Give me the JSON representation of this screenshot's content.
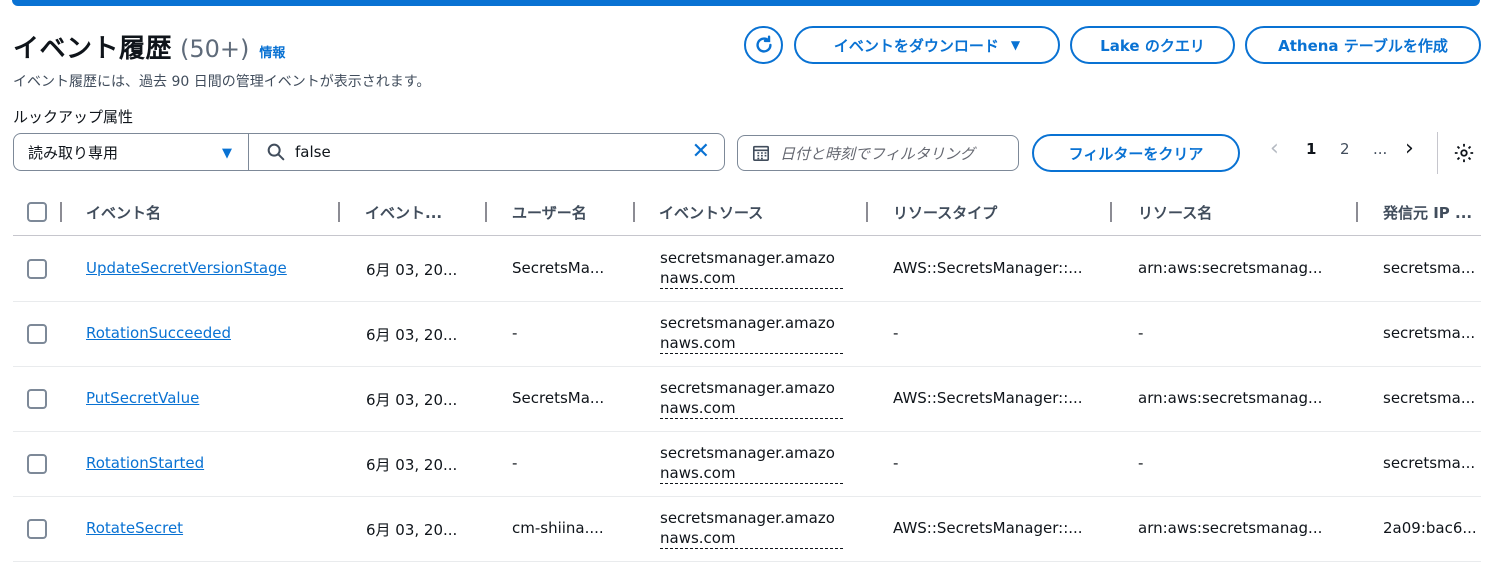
{
  "header": {
    "title": "イベント履歴",
    "count": "(50+)",
    "info_link": "情報",
    "description": "イベント履歴には、過去 90 日間の管理イベントが表示されます。"
  },
  "actions": {
    "download_label": "イベントをダウンロード",
    "lake_label": "Lake のクエリ",
    "athena_label": "Athena テーブルを作成"
  },
  "filter": {
    "lookup_label": "ルックアップ属性",
    "lookup_value": "読み取り専用",
    "search_value": "false",
    "date_placeholder": "日付と時刻でフィルタリング",
    "clear_label": "フィルターをクリア"
  },
  "pagination": {
    "pages": [
      "1",
      "2",
      "..."
    ],
    "current": "1"
  },
  "table": {
    "columns": [
      "イベント名",
      "イベント...",
      "ユーザー名",
      "イベントソース",
      "リソースタイプ",
      "リソース名",
      "発信元 IP ..."
    ],
    "rows": [
      {
        "event_name": "UpdateSecretVersionStage",
        "event_time": "6月 03, 20...",
        "user": "SecretsMa...",
        "source_line1": "secretsmanager.amazo",
        "source_line2": "naws.com",
        "resource_type": "AWS::SecretsManager::...",
        "resource_name": "arn:aws:secretsmanag...",
        "source_ip": "secretsma..."
      },
      {
        "event_name": "RotationSucceeded",
        "event_time": "6月 03, 20...",
        "user": "-",
        "source_line1": "secretsmanager.amazo",
        "source_line2": "naws.com",
        "resource_type": "-",
        "resource_name": "-",
        "source_ip": "secretsma..."
      },
      {
        "event_name": "PutSecretValue",
        "event_time": "6月 03, 20...",
        "user": "SecretsMa...",
        "source_line1": "secretsmanager.amazo",
        "source_line2": "naws.com",
        "resource_type": "AWS::SecretsManager::...",
        "resource_name": "arn:aws:secretsmanag...",
        "source_ip": "secretsma..."
      },
      {
        "event_name": "RotationStarted",
        "event_time": "6月 03, 20...",
        "user": "-",
        "source_line1": "secretsmanager.amazo",
        "source_line2": "naws.com",
        "resource_type": "-",
        "resource_name": "-",
        "source_ip": "secretsma..."
      },
      {
        "event_name": "RotateSecret",
        "event_time": "6月 03, 20...",
        "user": "cm-shiina....",
        "source_line1": "secretsmanager.amazo",
        "source_line2": "naws.com",
        "resource_type": "AWS::SecretsManager::...",
        "resource_name": "arn:aws:secretsmanag...",
        "source_ip": "2a09:bac6..."
      }
    ]
  },
  "icons": {
    "refresh": "refresh-icon",
    "search": "search-icon",
    "clear": "close-icon",
    "calendar": "calendar-icon",
    "settings": "gear-icon"
  },
  "colors": {
    "accent": "#0972d3",
    "text": "#0f141a",
    "muted": "#5f6b7a"
  }
}
